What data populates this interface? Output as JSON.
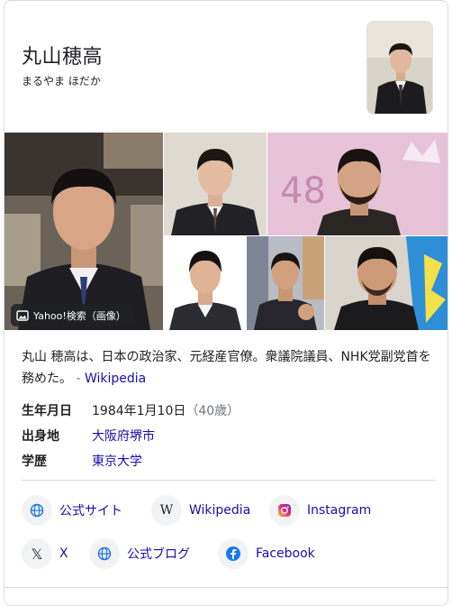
{
  "header": {
    "title": "丸山穂高",
    "subtitle": "まるやま ほだか"
  },
  "gallery": {
    "badge_label": "Yahoo!検索（画像）"
  },
  "description": {
    "text": "丸山 穂高は、日本の政治家、元経産官僚。衆議院議員、NHK党副党首を務めた。",
    "separator": "-",
    "source_link": "Wikipedia"
  },
  "facts": [
    {
      "label": "生年月日",
      "value": "1984年1月10日",
      "extra": "（40歳）"
    },
    {
      "label": "出身地",
      "value": "大阪府堺市"
    },
    {
      "label": "学歴",
      "value": "東京大学"
    }
  ],
  "links": [
    {
      "label": "公式サイト",
      "icon": "globe-icon"
    },
    {
      "label": "Wikipedia",
      "icon": "wikipedia-icon"
    },
    {
      "label": "Instagram",
      "icon": "instagram-icon"
    },
    {
      "label": "X",
      "icon": "x-icon"
    },
    {
      "label": "公式ブログ",
      "icon": "globe-icon"
    },
    {
      "label": "Facebook",
      "icon": "facebook-icon"
    }
  ],
  "colors": {
    "link": "#1a0dab",
    "facebook": "#1877f2",
    "globe": "#1a73e8"
  }
}
